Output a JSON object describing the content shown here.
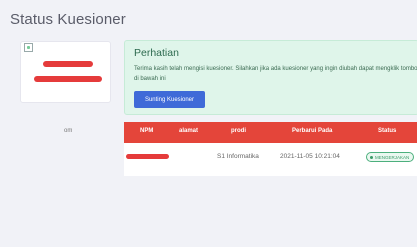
{
  "page": {
    "title": "Status Kuesioner"
  },
  "profile": {
    "caption": "om"
  },
  "alert": {
    "title": "Perhatian",
    "message": "Terima kasih telah mengisi kuesioner. Silahkan jika ada kuesioner yang ingin diubah dapat mengklik tombol di bawah ini",
    "button_label": "Sunting Kuesioner"
  },
  "table": {
    "headers": [
      "NPM",
      "alamat",
      "prodi",
      "Perbarui Pada",
      "Status"
    ],
    "rows": [
      {
        "prodi": "S1 Informatika",
        "updated": "2021-11-05 10:21:04",
        "status": "MENGERJAKAN"
      }
    ]
  },
  "colors": {
    "accent": "#3f6ad8",
    "table_header": "#e4453a",
    "alert_bg": "#dff5ea",
    "status": "#3a9a68",
    "redaction": "#e53b3b"
  }
}
